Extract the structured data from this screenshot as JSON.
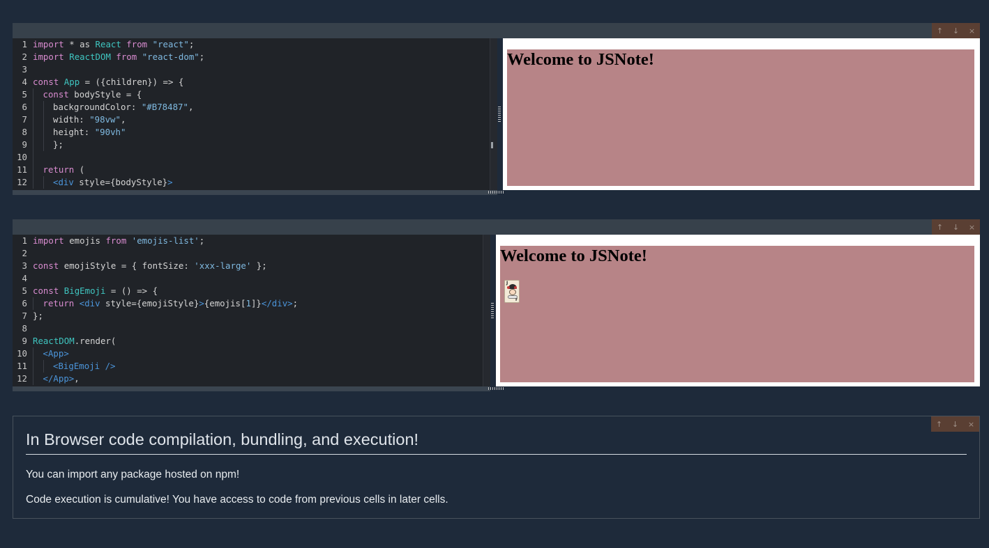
{
  "actions": {
    "move_up_icon": "↑",
    "move_down_icon": "↓",
    "delete_icon": "×"
  },
  "cells": [
    {
      "preview_title": "Welcome to JSNote!",
      "preview_bg_color": "#B78487",
      "code_lines": [
        {
          "ln": "1",
          "indent": 0,
          "tokens": [
            [
              "k",
              "import"
            ],
            [
              "p",
              " * as "
            ],
            [
              "t",
              "React"
            ],
            [
              "k",
              " from "
            ],
            [
              "s",
              "\"react\""
            ],
            [
              "p",
              ";"
            ]
          ]
        },
        {
          "ln": "2",
          "indent": 0,
          "tokens": [
            [
              "k",
              "import"
            ],
            [
              "p",
              " "
            ],
            [
              "t",
              "ReactDOM"
            ],
            [
              "k",
              " from "
            ],
            [
              "s",
              "\"react-dom\""
            ],
            [
              "p",
              ";"
            ]
          ]
        },
        {
          "ln": "3",
          "indent": 0,
          "tokens": []
        },
        {
          "ln": "4",
          "indent": 0,
          "tokens": [
            [
              "k",
              "const"
            ],
            [
              "p",
              " "
            ],
            [
              "t",
              "App"
            ],
            [
              "p",
              " = ({children}) => {"
            ]
          ]
        },
        {
          "ln": "5",
          "indent": 1,
          "tokens": [
            [
              "k",
              "const"
            ],
            [
              "p",
              " bodyStyle = {"
            ]
          ]
        },
        {
          "ln": "6",
          "indent": 2,
          "tokens": [
            [
              "p",
              "backgroundColor: "
            ],
            [
              "s",
              "\"#B78487\""
            ],
            [
              "p",
              ","
            ]
          ]
        },
        {
          "ln": "7",
          "indent": 2,
          "tokens": [
            [
              "p",
              "width: "
            ],
            [
              "s",
              "\"98vw\""
            ],
            [
              "p",
              ","
            ]
          ]
        },
        {
          "ln": "8",
          "indent": 2,
          "tokens": [
            [
              "p",
              "height: "
            ],
            [
              "s",
              "\"90vh\""
            ]
          ]
        },
        {
          "ln": "9",
          "indent": 2,
          "tokens": [
            [
              "p",
              "};"
            ]
          ]
        },
        {
          "ln": "10",
          "indent": 1,
          "tokens": []
        },
        {
          "ln": "11",
          "indent": 1,
          "tokens": [
            [
              "k",
              "return"
            ],
            [
              "p",
              " ("
            ]
          ]
        },
        {
          "ln": "12",
          "indent": 2,
          "tokens": [
            [
              "tag",
              "<div"
            ],
            [
              "p",
              " style={bodyStyle}"
            ],
            [
              "tag",
              ">"
            ]
          ]
        }
      ]
    },
    {
      "preview_title": "Welcome to JSNote!",
      "code_lines": [
        {
          "ln": "1",
          "indent": 0,
          "tokens": [
            [
              "k",
              "import"
            ],
            [
              "p",
              " emojis "
            ],
            [
              "k",
              "from"
            ],
            [
              "p",
              " "
            ],
            [
              "s",
              "'emojis-list'"
            ],
            [
              "p",
              ";"
            ]
          ]
        },
        {
          "ln": "2",
          "indent": 0,
          "tokens": []
        },
        {
          "ln": "3",
          "indent": 0,
          "tokens": [
            [
              "k",
              "const"
            ],
            [
              "p",
              " emojiStyle = { fontSize: "
            ],
            [
              "s",
              "'xxx-large'"
            ],
            [
              "p",
              " };"
            ]
          ]
        },
        {
          "ln": "4",
          "indent": 0,
          "tokens": []
        },
        {
          "ln": "5",
          "indent": 0,
          "tokens": [
            [
              "k",
              "const"
            ],
            [
              "p",
              " "
            ],
            [
              "t",
              "BigEmoji"
            ],
            [
              "p",
              " = () => {"
            ]
          ]
        },
        {
          "ln": "6",
          "indent": 1,
          "tokens": [
            [
              "k",
              "return"
            ],
            [
              "p",
              " "
            ],
            [
              "tag",
              "<div"
            ],
            [
              "p",
              " style={emojiStyle}"
            ],
            [
              "tag",
              ">"
            ],
            [
              "p",
              "{emojis["
            ],
            [
              "s",
              "1"
            ],
            [
              "p",
              "]}"
            ],
            [
              "tag",
              "</div>"
            ],
            [
              "p",
              ";"
            ]
          ]
        },
        {
          "ln": "7",
          "indent": 0,
          "tokens": [
            [
              "p",
              "};"
            ]
          ]
        },
        {
          "ln": "8",
          "indent": 0,
          "tokens": []
        },
        {
          "ln": "9",
          "indent": 0,
          "tokens": [
            [
              "t",
              "ReactDOM"
            ],
            [
              "p",
              ".render("
            ]
          ]
        },
        {
          "ln": "10",
          "indent": 1,
          "tokens": [
            [
              "tag",
              "<App>"
            ]
          ]
        },
        {
          "ln": "11",
          "indent": 2,
          "tokens": [
            [
              "tag",
              "<BigEmoji />"
            ]
          ]
        },
        {
          "ln": "12",
          "indent": 1,
          "tokens": [
            [
              "tag",
              "</App>"
            ],
            [
              "p",
              ","
            ]
          ]
        }
      ]
    }
  ],
  "markdown": {
    "title": "In Browser code compilation, bundling, and execution!",
    "p1": "You can import any package hosted on npm!",
    "p2": "Code execution is cumulative! You have access to code from previous cells in later cells."
  }
}
